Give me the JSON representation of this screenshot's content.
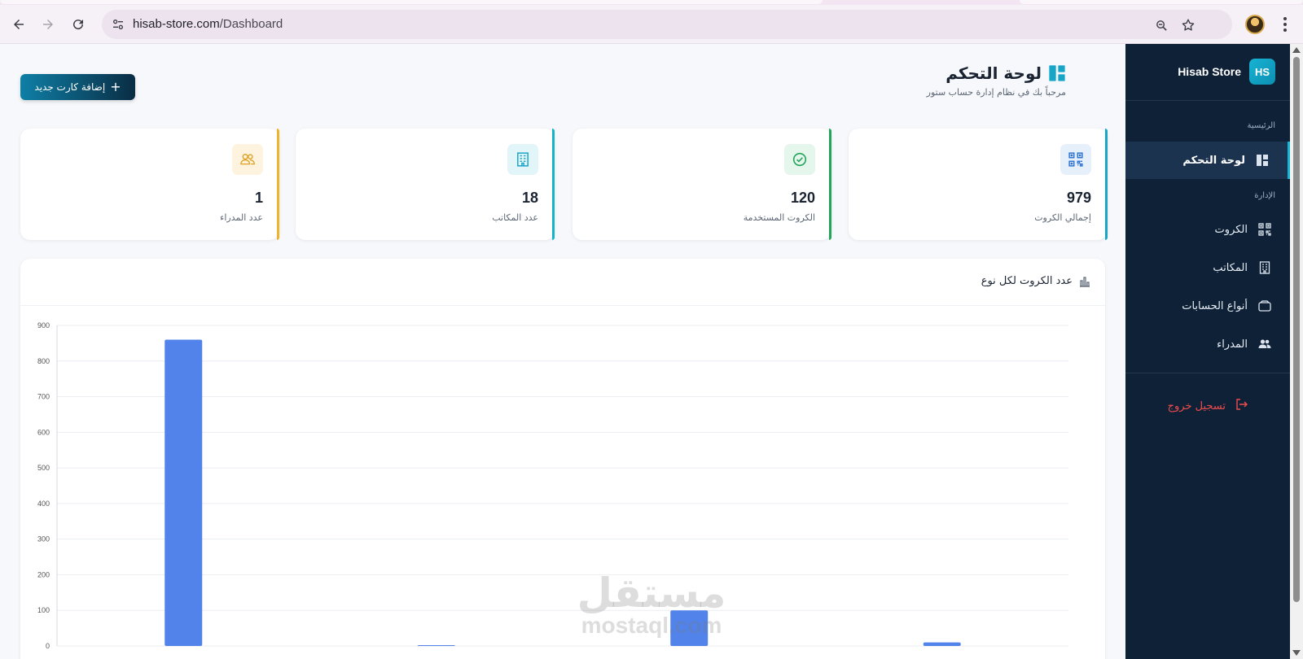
{
  "browser": {
    "url_host": "hisab-store.com",
    "url_path": "/Dashboard"
  },
  "sidebar": {
    "brand_logo": "HS",
    "brand_name": "Hisab Store",
    "section_main": "الرئيسية",
    "section_admin": "الإدارة",
    "items": [
      {
        "label": "لوحة التحكم",
        "icon": "dashboard-icon",
        "active": true
      },
      {
        "label": "الكروت",
        "icon": "qr-code-icon",
        "active": false
      },
      {
        "label": "المكاتب",
        "icon": "building-icon",
        "active": false
      },
      {
        "label": "أنواع الحسابات",
        "icon": "wallet-icon",
        "active": false
      },
      {
        "label": "المدراء",
        "icon": "users-icon",
        "active": false
      }
    ],
    "logout_label": "تسجيل خروج"
  },
  "header": {
    "title": "لوحة التحكم",
    "subtitle": "مرحباً بك في نظام إدارة حساب ستور",
    "add_button": "إضافة كارت جديد"
  },
  "stats": [
    {
      "value": "979",
      "label": "إجمالي الكروت",
      "icon": "qr-code-icon",
      "accent": "#17a5c8",
      "icon_bg": "#e6f0fb",
      "icon_color": "#2f74d0"
    },
    {
      "value": "120",
      "label": "الكروت المستخدمة",
      "icon": "check-circle-icon",
      "accent": "#22a45a",
      "icon_bg": "#e5f6ec",
      "icon_color": "#22a45a"
    },
    {
      "value": "18",
      "label": "عدد المكاتب",
      "icon": "building-icon",
      "accent": "#17b3c8",
      "icon_bg": "#e2f6f9",
      "icon_color": "#17a5c8"
    },
    {
      "value": "1",
      "label": "عدد المدراء",
      "icon": "users-icon",
      "accent": "#f0b429",
      "icon_bg": "#fdf3de",
      "icon_color": "#e0a020"
    }
  ],
  "chart_card": {
    "title": "عدد الكروت لكل نوع"
  },
  "chart_data": {
    "type": "bar",
    "title": "",
    "xlabel": "",
    "ylabel": "",
    "categories": [
      "",
      "",
      "",
      ""
    ],
    "values": [
      860,
      1,
      100,
      10
    ],
    "ylim": [
      0,
      900
    ],
    "yticks": [
      0,
      100,
      200,
      300,
      400,
      500,
      600,
      700,
      800,
      900
    ],
    "grid": true,
    "legend": "none",
    "bar_color": "#5283ea"
  },
  "watermark": {
    "arabic": "مستقل",
    "latin": "mostaql.com"
  }
}
